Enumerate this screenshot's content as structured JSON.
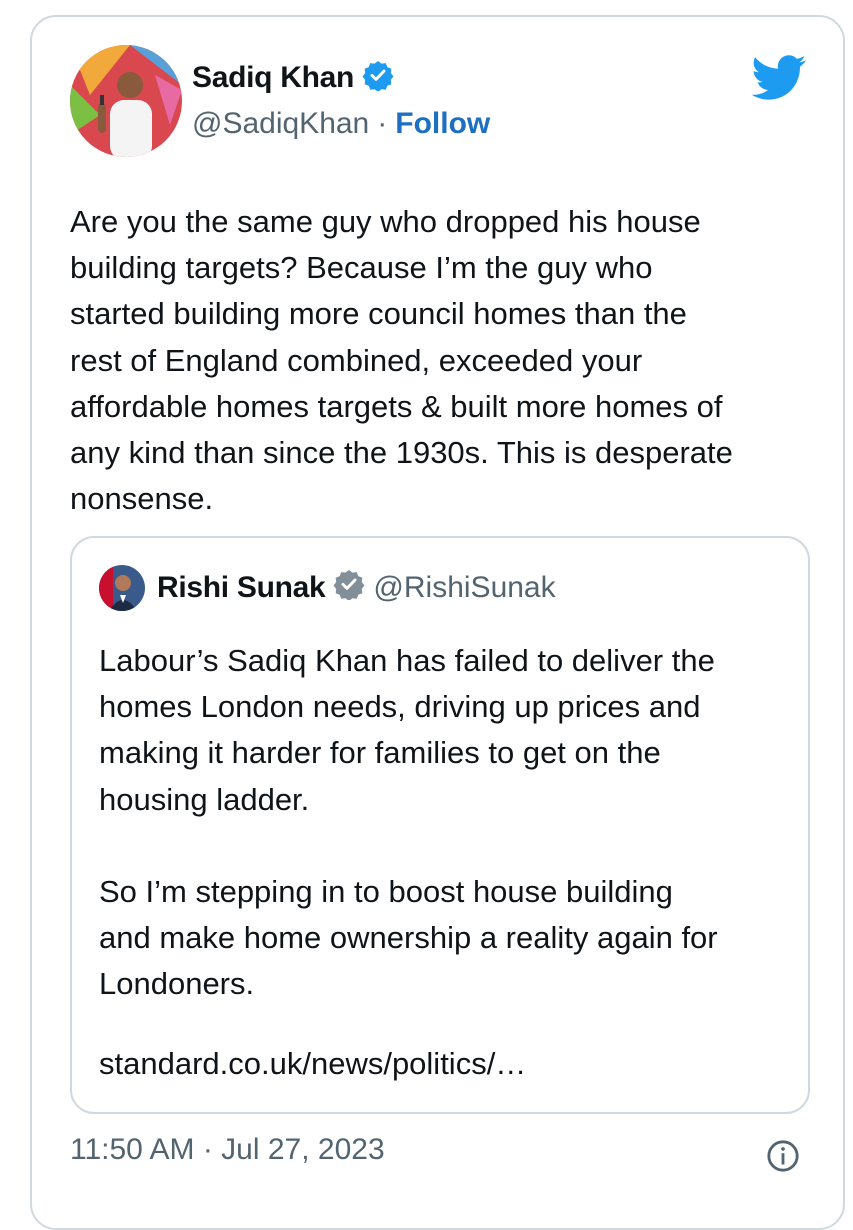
{
  "author": {
    "name": "Sadiq Khan",
    "handle": "@SadiqKhan",
    "separator": "·",
    "follow_label": "Follow",
    "verified_icon": "verified-badge-icon",
    "avatar_icon": "avatar"
  },
  "platform_icon": "twitter-bird-icon",
  "tweet": {
    "text": "Are you the same guy who dropped his house\nbuilding targets? Because I’m the guy who\nstarted building more council homes than the\nrest of England combined, exceeded your\naffordable homes targets & built more homes of\nany kind than since the 1930s. This is desperate\nnonsense."
  },
  "quoted": {
    "name": "Rishi Sunak",
    "handle": "@RishiSunak",
    "text": "Labour’s Sadiq Khan has failed to deliver the\nhomes London needs, driving up prices and\nmaking it harder for families to get on the\nhousing ladder.\n\nSo I’m stepping in to boost house building\nand make home ownership a reality again for\nLondoners.",
    "link": "standard.co.uk/news/politics/…"
  },
  "timestamp": "11:50 AM · Jul 27, 2023",
  "colors": {
    "accent": "#1d9bf0",
    "link": "#1d6fc2",
    "secondary_text": "#536471",
    "border": "#cfd9de",
    "verified_gray": "#828f99"
  }
}
